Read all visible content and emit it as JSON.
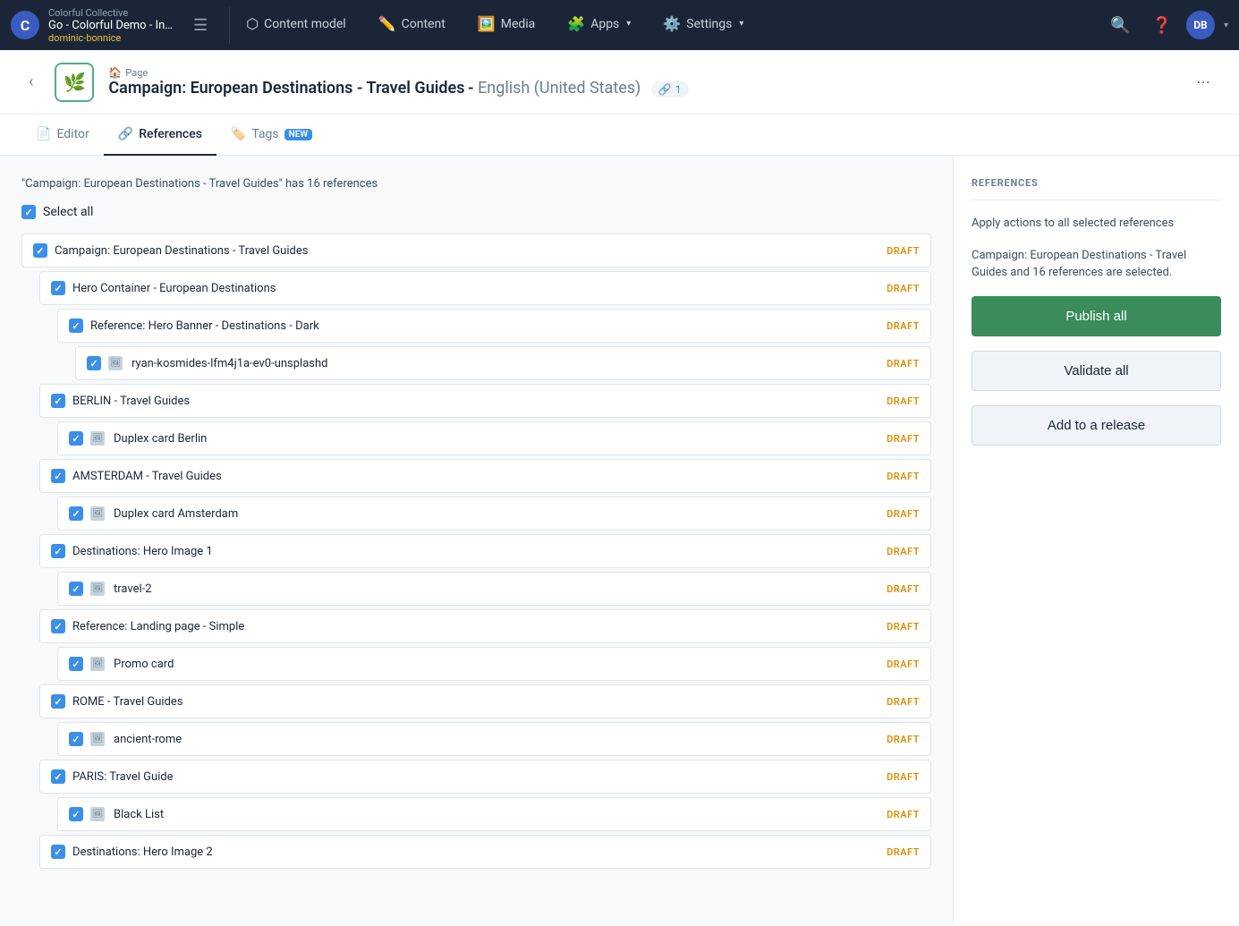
{
  "nav": {
    "org": "Colorful Collective",
    "title": "Go - Colorful Demo - Inte...",
    "user": "dominic-bonnice",
    "logo_letter": "C",
    "items": [
      {
        "label": "Content model",
        "icon": "⬡"
      },
      {
        "label": "Content",
        "icon": "✏️"
      },
      {
        "label": "Media",
        "icon": "🖼️"
      },
      {
        "label": "Apps",
        "icon": "🧩",
        "hasArrow": true
      },
      {
        "label": "Settings",
        "icon": "⚙️",
        "hasArrow": true
      }
    ],
    "avatar": "DB"
  },
  "entry": {
    "type": "Page",
    "icon": "🌿",
    "title": "Campaign: European Destinations - Travel Guides",
    "lang": "English (United States)",
    "link_count": "1"
  },
  "tabs": [
    {
      "label": "Editor",
      "icon": "📄",
      "active": false
    },
    {
      "label": "References",
      "icon": "🔗",
      "active": true
    },
    {
      "label": "Tags",
      "icon": "🏷️",
      "active": false,
      "badge": "NEW"
    }
  ],
  "references_panel": {
    "info_text": "\"Campaign: European Destinations - Travel Guides\" has 16 references",
    "select_all_label": "Select all",
    "title": "REFERENCES",
    "action_desc": "Apply actions to all selected references",
    "selection_info": "Campaign: European Destinations - Travel Guides and 16 references are selected.",
    "btn_publish": "Publish all",
    "btn_validate": "Validate all",
    "btn_release": "Add to a release"
  },
  "ref_items": [
    {
      "id": 1,
      "indent": 0,
      "name": "Campaign: European Destinations - Travel Guides",
      "status": "DRAFT",
      "is_media": false,
      "checked": true
    },
    {
      "id": 2,
      "indent": 1,
      "name": "Hero Container - European Destinations",
      "status": "DRAFT",
      "is_media": false,
      "checked": true
    },
    {
      "id": 3,
      "indent": 2,
      "name": "Reference: Hero Banner - Destinations - Dark",
      "status": "DRAFT",
      "is_media": false,
      "checked": true
    },
    {
      "id": 4,
      "indent": 3,
      "name": "ryan-kosmides-lfm4j1a-ev0-unsplashd",
      "status": "DRAFT",
      "is_media": true,
      "checked": true
    },
    {
      "id": 5,
      "indent": 1,
      "name": "BERLIN - Travel Guides",
      "status": "DRAFT",
      "is_media": false,
      "checked": true
    },
    {
      "id": 6,
      "indent": 2,
      "name": "Duplex card Berlin",
      "status": "DRAFT",
      "is_media": true,
      "checked": true
    },
    {
      "id": 7,
      "indent": 1,
      "name": "AMSTERDAM - Travel Guides",
      "status": "DRAFT",
      "is_media": false,
      "checked": true
    },
    {
      "id": 8,
      "indent": 2,
      "name": "Duplex card Amsterdam",
      "status": "DRAFT",
      "is_media": true,
      "checked": true
    },
    {
      "id": 9,
      "indent": 1,
      "name": "Destinations: Hero Image 1",
      "status": "DRAFT",
      "is_media": false,
      "checked": true
    },
    {
      "id": 10,
      "indent": 2,
      "name": "travel-2",
      "status": "DRAFT",
      "is_media": true,
      "checked": true
    },
    {
      "id": 11,
      "indent": 1,
      "name": "Reference: Landing page - Simple",
      "status": "DRAFT",
      "is_media": false,
      "checked": true
    },
    {
      "id": 12,
      "indent": 2,
      "name": "Promo card",
      "status": "DRAFT",
      "is_media": true,
      "checked": true
    },
    {
      "id": 13,
      "indent": 1,
      "name": "ROME - Travel Guides",
      "status": "DRAFT",
      "is_media": false,
      "checked": true
    },
    {
      "id": 14,
      "indent": 2,
      "name": "ancient-rome",
      "status": "DRAFT",
      "is_media": true,
      "checked": true
    },
    {
      "id": 15,
      "indent": 1,
      "name": "PARIS: Travel Guide",
      "status": "DRAFT",
      "is_media": false,
      "checked": true
    },
    {
      "id": 16,
      "indent": 2,
      "name": "Black List",
      "status": "DRAFT",
      "is_media": true,
      "checked": true
    },
    {
      "id": 17,
      "indent": 1,
      "name": "Destinations: Hero Image 2",
      "status": "DRAFT",
      "is_media": false,
      "checked": true
    }
  ]
}
